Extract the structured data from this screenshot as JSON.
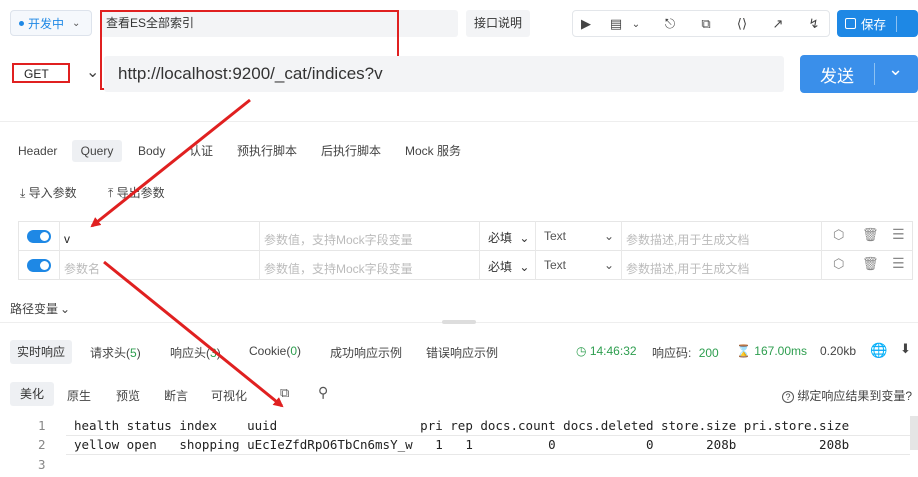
{
  "header": {
    "status": "开发中",
    "api_name": "查看ES全部索引",
    "doc_button": "接口说明",
    "save_button": "保存"
  },
  "request": {
    "method": "GET",
    "url": "http://localhost:9200/_cat/indices?v",
    "send_button": "发送"
  },
  "request_tabs": [
    "Header",
    "Query",
    "Body",
    "认证",
    "预执行脚本",
    "后执行脚本",
    "Mock 服务"
  ],
  "param_actions": {
    "import": "导入参数",
    "export": "导出参数"
  },
  "params": [
    {
      "name": "v",
      "name_placeholder": "参数名",
      "value_placeholder": "参数值，支持Mock字段变量",
      "required": "必填",
      "type": "Text",
      "desc_placeholder": "参数描述,用于生成文档"
    },
    {
      "name": "",
      "name_placeholder": "参数名",
      "value_placeholder": "参数值，支持Mock字段变量",
      "required": "必填",
      "type": "Text",
      "desc_placeholder": "参数描述,用于生成文档"
    }
  ],
  "path_variables": "路径变量",
  "response_tabs": {
    "realtime": "实时响应",
    "req_headers": "请求头",
    "req_headers_count": "5",
    "resp_headers": "响应头",
    "resp_headers_count": "3",
    "cookie": "Cookie",
    "cookie_count": "0",
    "success_example": "成功响应示例",
    "error_example": "错误响应示例"
  },
  "response_meta": {
    "time": "14:46:32",
    "status_label": "响应码:",
    "status_code": "200",
    "duration": "167.00ms",
    "size": "0.20kb"
  },
  "view_tabs": [
    "美化",
    "原生",
    "预览",
    "断言",
    "可视化"
  ],
  "bind_result": "绑定响应结果到变量?",
  "response_lines": [
    {
      "num": "1",
      "text": "health status index    uuid                   pri rep docs.count docs.deleted store.size pri.store.size"
    },
    {
      "num": "2",
      "text": "yellow open   shopping uEcIeZfdRpO6TbCn6msY_w   1   1          0            0       208b           208b"
    },
    {
      "num": "3",
      "text": ""
    }
  ],
  "colors": {
    "accent": "#1e88e5",
    "annotation": "#e02020",
    "success": "#2e9e4f"
  }
}
